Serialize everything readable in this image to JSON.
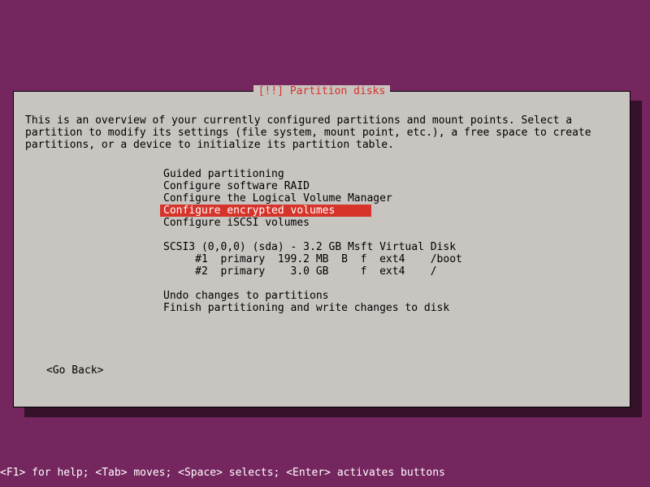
{
  "dialog": {
    "title": "[!!] Partition disks",
    "intro": "This is an overview of your currently configured partitions and mount points. Select a\npartition to modify its settings (file system, mount point, etc.), a free space to create\npartitions, or a device to initialize its partition table.",
    "go_back": "<Go Back>"
  },
  "menu": [
    {
      "label": "Guided partitioning",
      "selected": false
    },
    {
      "label": "Configure software RAID",
      "selected": false
    },
    {
      "label": "Configure the Logical Volume Manager",
      "selected": false
    },
    {
      "label": "Configure encrypted volumes",
      "selected": true
    },
    {
      "label": "Configure iSCSI volumes",
      "selected": false
    },
    {
      "blank": true
    },
    {
      "label": "SCSI3 (0,0,0) (sda) - 3.2 GB Msft Virtual Disk",
      "selected": false
    },
    {
      "label": "     #1  primary  199.2 MB  B  f  ext4    /boot",
      "selected": false
    },
    {
      "label": "     #2  primary    3.0 GB     f  ext4    /",
      "selected": false
    },
    {
      "blank": true
    },
    {
      "label": "Undo changes to partitions",
      "selected": false
    },
    {
      "label": "Finish partitioning and write changes to disk",
      "selected": false
    }
  ],
  "footer": "<F1> for help; <Tab> moves; <Space> selects; <Enter> activates buttons"
}
